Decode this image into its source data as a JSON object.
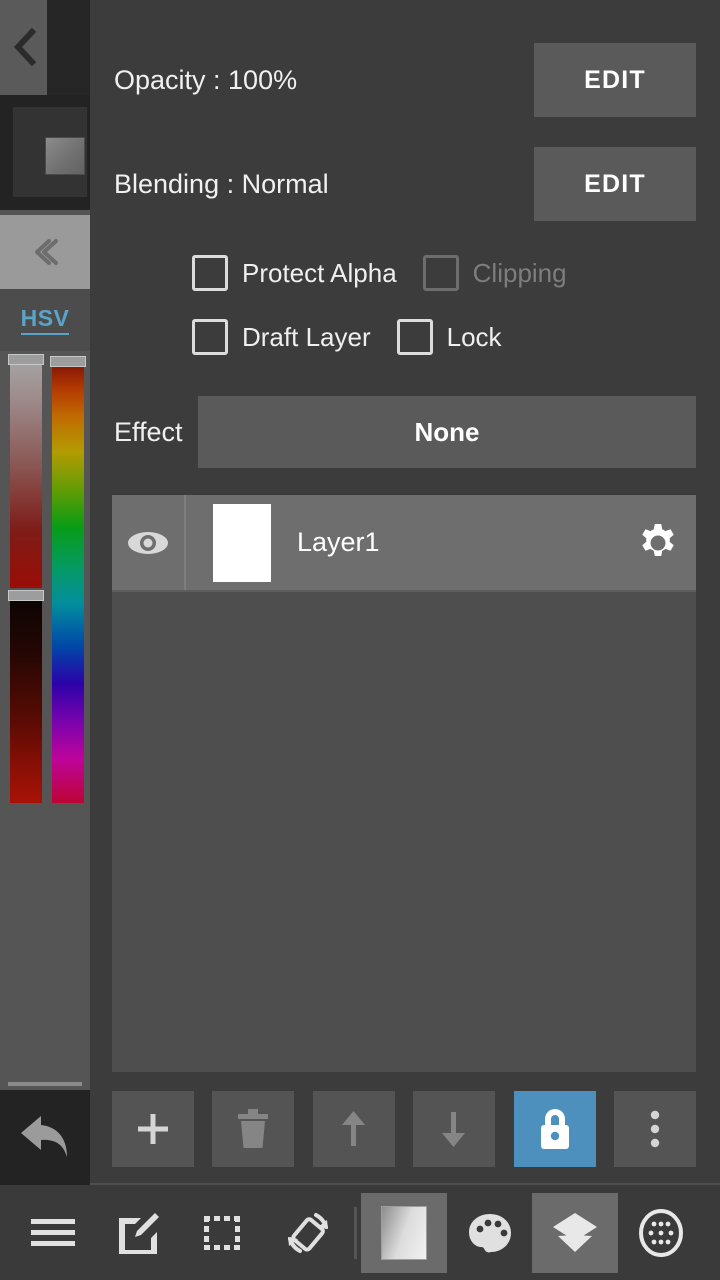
{
  "app": {
    "panel_name": "layer-properties-panel"
  },
  "color_rail": {
    "back_icon": "chevron-left-icon",
    "collapse_icon": "double-chevron-left-icon",
    "mode_label": "HSV",
    "undo_icon": "undo-arrow-icon",
    "sliders": [
      {
        "name": "saturation-value-slider",
        "thumb_position_pct": 0
      },
      {
        "name": "value-slider",
        "thumb_position_pct": 52
      },
      {
        "name": "hue-slider",
        "thumb_position_pct": 1
      }
    ]
  },
  "properties": {
    "opacity_label": "Opacity : 100%",
    "opacity_value": "100%",
    "opacity_edit_label": "EDIT",
    "blending_label": "Blending : Normal",
    "blending_value": "Normal",
    "blending_edit_label": "EDIT"
  },
  "checkboxes": [
    {
      "label": "Protect Alpha",
      "checked": false,
      "disabled": false
    },
    {
      "label": "Clipping",
      "checked": false,
      "disabled": true
    },
    {
      "label": "Draft Layer",
      "checked": false,
      "disabled": false
    },
    {
      "label": "Lock",
      "checked": false,
      "disabled": false
    }
  ],
  "effect": {
    "label": "Effect",
    "value": "None"
  },
  "layers": [
    {
      "name": "Layer1",
      "visible": true,
      "selected": true,
      "visibility_icon": "eye-icon",
      "settings_icon": "gear-icon"
    }
  ],
  "layer_actions": [
    {
      "name": "add-layer-button",
      "icon": "plus-icon",
      "enabled": true,
      "active": false
    },
    {
      "name": "delete-layer-button",
      "icon": "trash-icon",
      "enabled": false,
      "active": false
    },
    {
      "name": "move-layer-up-button",
      "icon": "arrow-up-icon",
      "enabled": false,
      "active": false
    },
    {
      "name": "move-layer-down-button",
      "icon": "arrow-down-icon",
      "enabled": false,
      "active": false
    },
    {
      "name": "lock-layer-button",
      "icon": "lock-icon",
      "enabled": true,
      "active": true
    },
    {
      "name": "layer-more-button",
      "icon": "more-vertical-icon",
      "enabled": true,
      "active": false
    }
  ],
  "bottom_nav": [
    {
      "name": "menu-tab",
      "icon": "hamburger-menu-icon",
      "active": false
    },
    {
      "name": "draw-tab",
      "icon": "edit-pencil-icon",
      "active": false
    },
    {
      "name": "select-tab",
      "icon": "marquee-selection-icon",
      "active": false
    },
    {
      "name": "rotate-tab",
      "icon": "rotate-canvas-icon",
      "active": false
    },
    {
      "name": "canvas-tab",
      "icon": "canvas-square-icon",
      "active": true
    },
    {
      "name": "palette-tab",
      "icon": "color-palette-icon",
      "active": false
    },
    {
      "name": "layers-tab",
      "icon": "layers-stack-icon",
      "active": true
    },
    {
      "name": "brush-tab",
      "icon": "dotted-circle-brush-icon",
      "active": false
    }
  ],
  "colors": {
    "panel_bg": "#3c3c3c",
    "rail_bg": "#555555",
    "layer_list_bg": "#4e4e4e",
    "layer_selected": "#6e6e6e",
    "button_bg": "#5a5a5a",
    "accent_blue": "#4d8fbd",
    "hsv_label": "#5aa4c8",
    "text": "#f0f0f0",
    "text_disabled": "#7d7d7d"
  }
}
